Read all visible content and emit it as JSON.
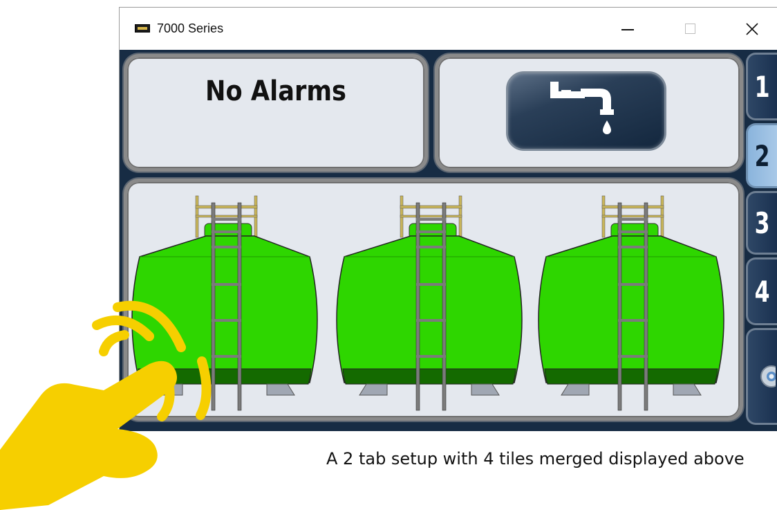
{
  "window": {
    "title": "7000 Series",
    "controls": {
      "minimize": "minimize",
      "maximize": "maximize",
      "close": "close"
    }
  },
  "alarm_panel": {
    "status": "No Alarms"
  },
  "pump_button": {
    "icon": "tap-water-icon"
  },
  "tanks": [
    {
      "name": "tank-1",
      "color": "#2ed600"
    },
    {
      "name": "tank-2",
      "color": "#2ed600"
    },
    {
      "name": "tank-3",
      "color": "#2ed600"
    }
  ],
  "side_tabs": [
    {
      "label": "1",
      "active": false
    },
    {
      "label": "2",
      "active": true
    },
    {
      "label": "3",
      "active": false
    },
    {
      "label": "4",
      "active": false
    },
    {
      "label": "",
      "icon": "gear-icon"
    }
  ],
  "caption": "A 2 tab setup with 4 tiles merged displayed above",
  "colors": {
    "background": "#172c44",
    "panel": "#e4e8ee",
    "tank_green": "#2ed600",
    "tab_active": "#a9c9e8",
    "hand": "#f6cf00"
  }
}
